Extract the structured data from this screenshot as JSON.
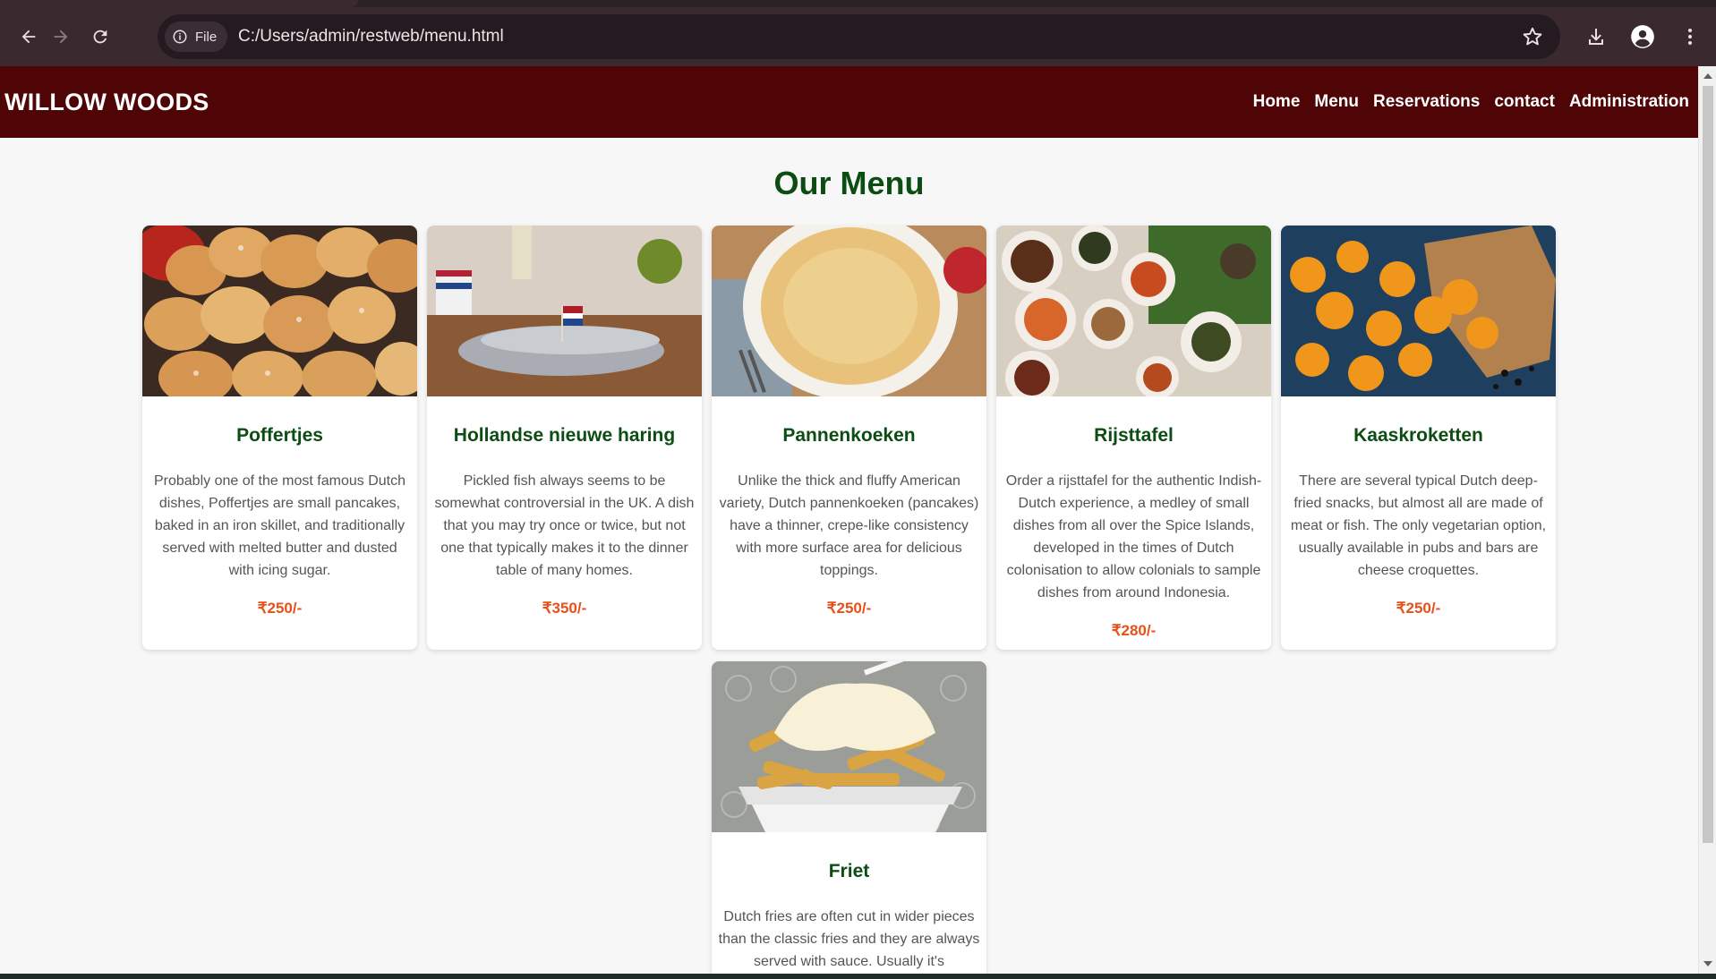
{
  "browser": {
    "url": "C:/Users/admin/restweb/menu.html",
    "chip_label": "File",
    "icons": [
      "back-icon",
      "forward-icon",
      "reload-icon",
      "info-icon",
      "star-icon",
      "download-icon",
      "profile-icon",
      "kebab-menu-icon"
    ]
  },
  "site": {
    "logo": "WILLOW WOODS",
    "nav": [
      "Home",
      "Menu",
      "Reservations",
      "contact",
      "Administration"
    ],
    "heading": "Our Menu"
  },
  "colors": {
    "header_bg": "#4f0505",
    "heading_green": "#0b4d12",
    "price_orange": "#e8501a"
  },
  "menu": [
    {
      "name": "Poffertjes",
      "description": "Probably one of the most famous Dutch dishes, Poffertjes are small pancakes, baked in an iron skillet, and traditionally served with melted butter and dusted with icing sugar.",
      "price": "₹250/-"
    },
    {
      "name": "Hollandse nieuwe haring",
      "description": "Pickled fish always seems to be somewhat controversial in the UK. A dish that you may try once or twice, but not one that typically makes it to the dinner table of many homes.",
      "price": "₹350/-"
    },
    {
      "name": "Pannenkoeken",
      "description": "Unlike the thick and fluffy American variety, Dutch pannenkoeken (pancakes) have a thinner, crepe-like consistency with more surface area for delicious toppings.",
      "price": "₹250/-"
    },
    {
      "name": "Rijsttafel",
      "description": "Order a rijsttafel for the authentic Indish-Dutch experience, a medley of small dishes from all over the Spice Islands, developed in the times of Dutch colonisation to allow colonials to sample dishes from around Indonesia.",
      "price": "₹280/-"
    },
    {
      "name": "Kaaskroketten",
      "description": "There are several typical Dutch deep-fried snacks, but almost all are made of meat or fish. The only vegetarian option, usually available in pubs and bars are cheese croquettes.",
      "price": "₹250/-"
    },
    {
      "name": "Friet",
      "description": "Dutch fries are often cut in wider pieces than the classic fries and they are always served with sauce. Usually it's",
      "price": ""
    }
  ]
}
